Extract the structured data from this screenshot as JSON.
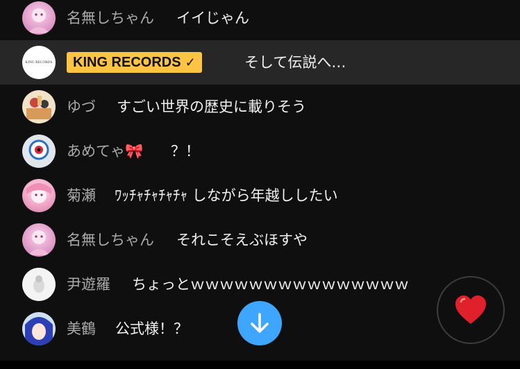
{
  "chat": {
    "messages": [
      {
        "author": "名無しちゃん",
        "text": "イイじゃん"
      },
      {
        "author": "KING RECORDS",
        "text": "そして伝説へ…",
        "badge": "verified-check-icon",
        "avatar_text": "KING RECORDS"
      },
      {
        "author": "ゆづ",
        "text": "すごい世界の歴史に載りそう"
      },
      {
        "author": "あめてゃ🎀",
        "text": "？！"
      },
      {
        "author": "菊瀬",
        "text": "ﾜｯﾁｬﾁｬﾁｬﾁｬ しながら年越ししたい"
      },
      {
        "author": "名無しちゃん",
        "text": "それこそえぶほすや"
      },
      {
        "author": "尹遊羅",
        "text": "ちょっとｗｗｗｗｗｗｗｗｗｗｗｗｗｗｗ"
      },
      {
        "author": "美鶴",
        "text": "公式様！？"
      }
    ]
  },
  "controls": {
    "scroll_down_icon": "arrow-down-icon",
    "reaction_icon": "heart-icon"
  },
  "colors": {
    "background": "#0f0f0f",
    "pinned_row": "#272727",
    "badge": "#ffc444",
    "author": "#aaaaaa",
    "message": "#f1f1f1",
    "scroll_button": "#3ea6ff",
    "heart": "#e0202a"
  }
}
